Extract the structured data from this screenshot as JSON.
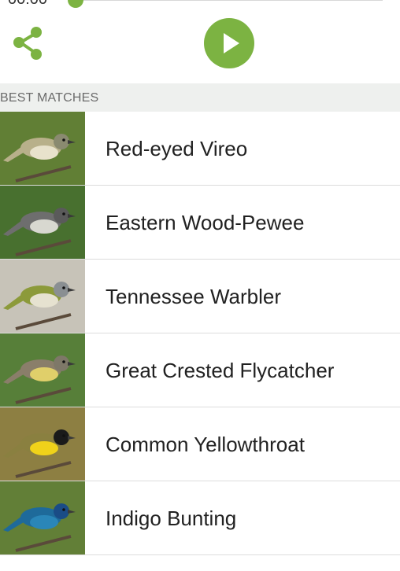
{
  "player": {
    "time": "00:00",
    "progress": 0,
    "accent": "#7cb342",
    "share_icon": "share-icon",
    "play_icon": "play-icon"
  },
  "section": {
    "title": "BEST MATCHES"
  },
  "birds": [
    {
      "name": "Red-eyed Vireo",
      "bg": "#6a8a3a",
      "body": "#b8b08a",
      "belly": "#e8e2cc",
      "head": "#8a8a70"
    },
    {
      "name": "Eastern Wood-Pewee",
      "bg": "#4f7a34",
      "body": "#6e6e6e",
      "belly": "#d8d8d0",
      "head": "#5a5a5a"
    },
    {
      "name": "Tennessee Warbler",
      "bg": "#d8d4c8",
      "body": "#8c9a3a",
      "belly": "#e6e2d0",
      "head": "#8a8f92"
    },
    {
      "name": "Great Crested Flycatcher",
      "bg": "#5f8a3e",
      "body": "#8a7e6a",
      "belly": "#e0cf6a",
      "head": "#7e7868"
    },
    {
      "name": "Common Yellowthroat",
      "bg": "#9a8a48",
      "body": "#8a8040",
      "belly": "#f0d21a",
      "head": "#1a1a1a"
    },
    {
      "name": "Indigo Bunting",
      "bg": "#6b8a3c",
      "body": "#1e6a9a",
      "belly": "#2a86b8",
      "head": "#1a4c86"
    }
  ]
}
